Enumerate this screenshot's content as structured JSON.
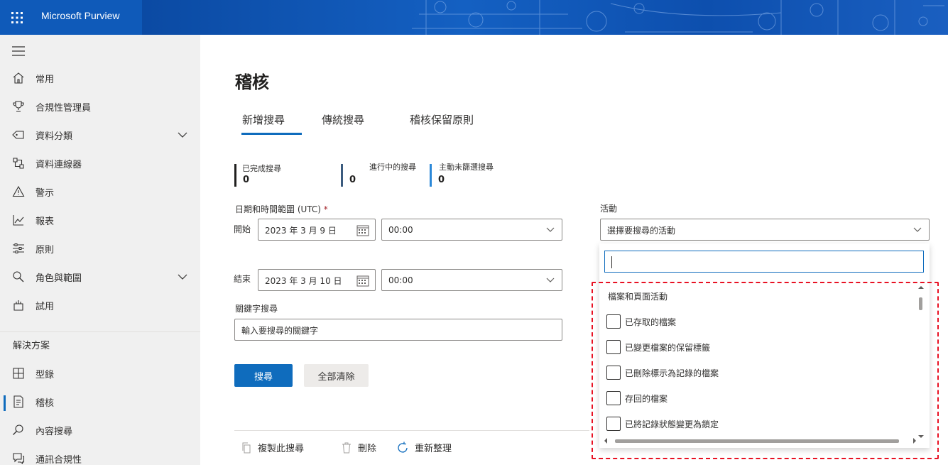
{
  "app": {
    "name": "Microsoft Purview"
  },
  "colors": {
    "brand": "#0f6cbd",
    "header": "#0f4fa8",
    "highlight": "#e81123"
  },
  "sidebar": {
    "items": [
      {
        "label": "常用",
        "icon": "home-icon"
      },
      {
        "label": "合規性管理員",
        "icon": "trophy-icon"
      },
      {
        "label": "資料分類",
        "icon": "tag-icon",
        "expandable": true
      },
      {
        "label": "資料連線器",
        "icon": "connector-icon"
      },
      {
        "label": "警示",
        "icon": "warning-icon"
      },
      {
        "label": "報表",
        "icon": "chart-icon"
      },
      {
        "label": "原則",
        "icon": "policy-icon"
      },
      {
        "label": "角色與範圍",
        "icon": "roles-icon",
        "expandable": true
      },
      {
        "label": "試用",
        "icon": "trial-icon"
      }
    ],
    "section_label": "解決方案",
    "solutions": [
      {
        "label": "型錄",
        "icon": "catalog-icon"
      },
      {
        "label": "稽核",
        "icon": "audit-icon",
        "active": true
      },
      {
        "label": "內容搜尋",
        "icon": "search-icon"
      },
      {
        "label": "通訊合規性",
        "icon": "communication-icon"
      }
    ]
  },
  "page": {
    "title": "稽核",
    "tabs": [
      {
        "label": "新增搜尋",
        "selected": true
      },
      {
        "label": "傳統搜尋"
      },
      {
        "label": "稽核保留原則"
      }
    ],
    "stats": [
      {
        "label": "已完成搜尋",
        "value": "0"
      },
      {
        "label": "進行中的搜尋",
        "value": "0"
      },
      {
        "label": "主動未篩選搜尋",
        "value": "0"
      }
    ],
    "date_range_label": "日期和時間範圍 (UTC)",
    "required_mark": "*",
    "start_label": "開始",
    "start_date": "2023 年 3 月 9 日",
    "start_time": "00:00",
    "end_label": "結束",
    "end_date": "2023 年 3 月 10 日",
    "end_time": "00:00",
    "keyword_label": "關鍵字搜尋",
    "keyword_placeholder": "輸入要搜尋的關鍵字",
    "activity_label": "活動",
    "activity_placeholder": "選擇要搜尋的活動",
    "search_button": "搜尋",
    "clear_button": "全部清除",
    "commands": [
      {
        "label": "複製此搜尋",
        "icon": "copy-icon"
      },
      {
        "label": "刪除",
        "icon": "trash-icon"
      },
      {
        "label": "重新整理",
        "icon": "refresh-icon"
      }
    ]
  },
  "activity_dropdown": {
    "search_value": "",
    "group_label": "檔案和頁面活動",
    "options": [
      {
        "label": "已存取的檔案",
        "checked": false
      },
      {
        "label": "已變更檔案的保留標籤",
        "checked": false
      },
      {
        "label": "已刪除標示為記錄的檔案",
        "checked": false
      },
      {
        "label": "存回的檔案",
        "checked": false
      },
      {
        "label": "已將記錄狀態變更為鎖定",
        "checked": false
      }
    ]
  }
}
